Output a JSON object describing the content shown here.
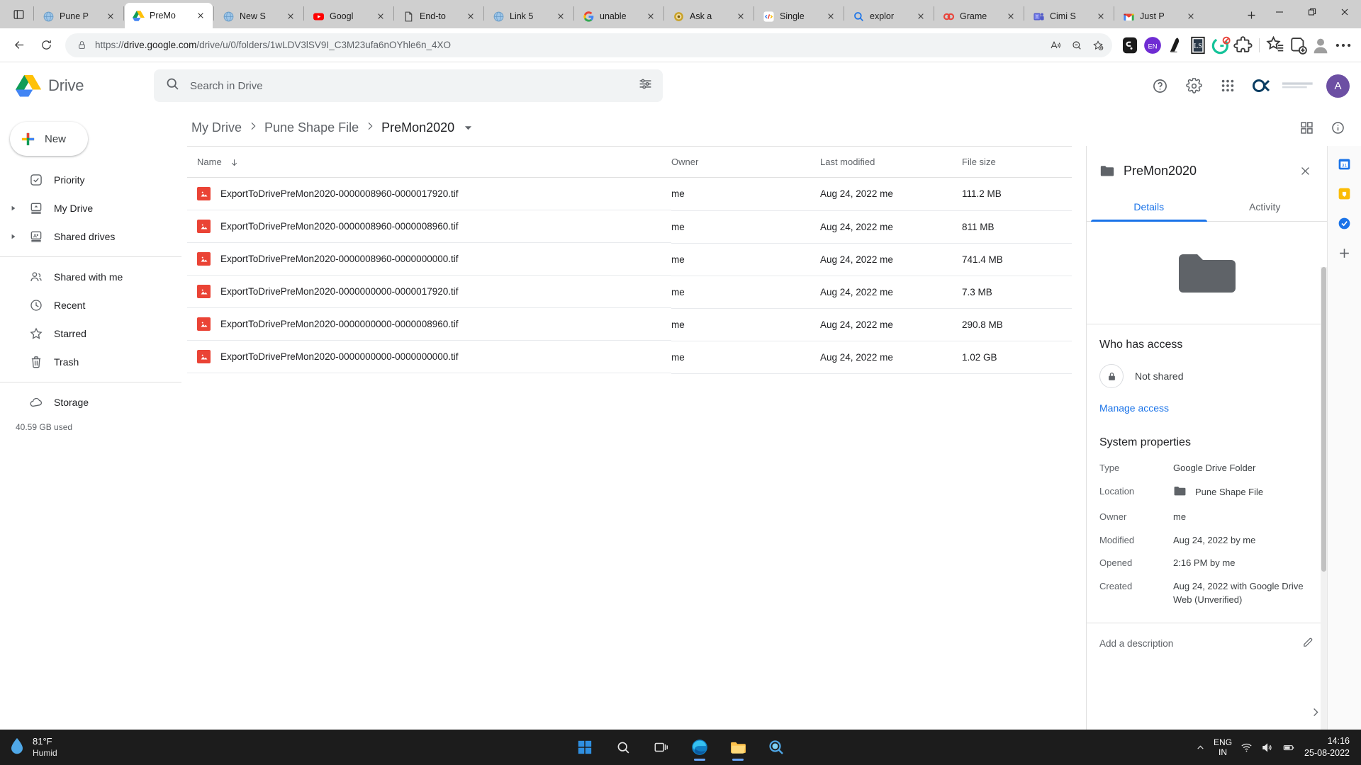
{
  "browser": {
    "tabs": [
      {
        "label": "Pune P",
        "icon": "globe-icon",
        "active": false
      },
      {
        "label": "PreMo",
        "icon": "drive-icon",
        "active": true
      },
      {
        "label": "New S",
        "icon": "globe-icon",
        "active": false
      },
      {
        "label": "Googl",
        "icon": "youtube-icon",
        "active": false
      },
      {
        "label": "End-to",
        "icon": "document-icon",
        "active": false
      },
      {
        "label": "Link 5",
        "icon": "globe-icon",
        "active": false
      },
      {
        "label": "unable",
        "icon": "google-icon",
        "active": false
      },
      {
        "label": "Ask a",
        "icon": "orb-icon",
        "active": false
      },
      {
        "label": "Single",
        "icon": "code-icon",
        "active": false
      },
      {
        "label": "explor",
        "icon": "search-icon",
        "active": false
      },
      {
        "label": "Grame",
        "icon": "grammarly-icon",
        "active": false
      },
      {
        "label": "Cimi S",
        "icon": "teams-icon",
        "active": false
      },
      {
        "label": "Just P",
        "icon": "gmail-icon",
        "active": false
      }
    ],
    "new_tab_label": "+",
    "url_prefix": "https://",
    "url_domain": "drive.google.com",
    "url_path": "/drive/u/0/folders/1wLDV3lSV9I_C3M23ufa6nOYhle6n_4XO",
    "window_controls": {
      "minimize": "—",
      "restore": "❐",
      "close": "✕"
    },
    "extensions": [
      "read-aloud-icon",
      "zoom-out-icon",
      "add-favorite-icon",
      "pocket-extension-icon",
      "en-extension-icon",
      "dark-bird-extension-icon",
      "ls-extension-icon",
      "grammarly-extension-icon",
      "puzzle-extension-icon",
      "favorites-icon",
      "collections-icon",
      "profile-icon",
      "settings-more-icon"
    ]
  },
  "drive": {
    "app_name": "Drive",
    "search": {
      "placeholder": "Search in Drive",
      "value": "",
      "filter_label": "search-options"
    },
    "header_actions": [
      "support-icon",
      "settings-icon",
      "apps-grid-icon"
    ],
    "org_badge": "OK",
    "account_initial": "A",
    "new_button": "New",
    "sidebar": {
      "items": [
        {
          "label": "Priority",
          "icon": "priority-check-icon",
          "expandable": false
        },
        {
          "label": "My Drive",
          "icon": "my-drive-icon",
          "expandable": true
        },
        {
          "label": "Shared drives",
          "icon": "shared-drives-icon",
          "expandable": true
        },
        {
          "label": "Shared with me",
          "icon": "people-icon",
          "expandable": false
        },
        {
          "label": "Recent",
          "icon": "clock-icon",
          "expandable": false
        },
        {
          "label": "Starred",
          "icon": "star-icon",
          "expandable": false
        },
        {
          "label": "Trash",
          "icon": "trash-icon",
          "expandable": false
        },
        {
          "label": "Storage",
          "icon": "cloud-icon",
          "expandable": false
        }
      ],
      "storage_used": "40.59 GB used"
    },
    "breadcrumbs": [
      {
        "label": "My Drive"
      },
      {
        "label": "Pune Shape File"
      },
      {
        "label": "PreMon2020"
      }
    ],
    "view_actions": [
      "grid-view-icon",
      "details-info-icon"
    ],
    "table": {
      "columns": [
        "Name",
        "Owner",
        "Last modified",
        "File size"
      ],
      "sort_column": "Name",
      "sort_direction": "descending",
      "rows": [
        {
          "name": "ExportToDrivePreMon2020-0000008960-0000017920.tif",
          "owner": "me",
          "modified": "Aug 24, 2022  me",
          "size": "111.2 MB",
          "icon": "image-file-icon"
        },
        {
          "name": "ExportToDrivePreMon2020-0000008960-0000008960.tif",
          "owner": "me",
          "modified": "Aug 24, 2022  me",
          "size": "811 MB",
          "icon": "image-file-icon"
        },
        {
          "name": "ExportToDrivePreMon2020-0000008960-0000000000.tif",
          "owner": "me",
          "modified": "Aug 24, 2022  me",
          "size": "741.4 MB",
          "icon": "image-file-icon"
        },
        {
          "name": "ExportToDrivePreMon2020-0000000000-0000017920.tif",
          "owner": "me",
          "modified": "Aug 24, 2022  me",
          "size": "7.3 MB",
          "icon": "image-file-icon"
        },
        {
          "name": "ExportToDrivePreMon2020-0000000000-0000008960.tif",
          "owner": "me",
          "modified": "Aug 24, 2022  me",
          "size": "290.8 MB",
          "icon": "image-file-icon"
        },
        {
          "name": "ExportToDrivePreMon2020-0000000000-0000000000.tif",
          "owner": "me",
          "modified": "Aug 24, 2022  me",
          "size": "1.02 GB",
          "icon": "image-file-icon"
        }
      ]
    },
    "details": {
      "title": "PreMon2020",
      "close_label": "✕",
      "tabs": [
        {
          "label": "Details",
          "active": true
        },
        {
          "label": "Activity",
          "active": false
        }
      ],
      "access_heading": "Who has access",
      "access_status": "Not shared",
      "manage_access": "Manage access",
      "system_heading": "System properties",
      "properties": [
        {
          "key": "Type",
          "value": "Google Drive Folder"
        },
        {
          "key": "Location",
          "value": "Pune Shape File"
        },
        {
          "key": "Owner",
          "value": "me"
        },
        {
          "key": "Modified",
          "value": "Aug 24, 2022 by me"
        },
        {
          "key": "Opened",
          "value": "2:16 PM by me"
        },
        {
          "key": "Created",
          "value": "Aug 24, 2022 with Google Drive Web (Unverified)"
        }
      ],
      "description_placeholder": "Add a description",
      "edit_icon": "pencil-icon"
    },
    "side_rail": [
      "calendar-addon-icon",
      "keep-addon-icon",
      "tasks-addon-icon",
      "add-addon-icon"
    ]
  },
  "taskbar": {
    "weather": {
      "temperature": "81°F",
      "condition": "Humid"
    },
    "apps": [
      "start-icon",
      "search-icon",
      "task-view-icon",
      "edge-icon",
      "file-explorer-icon",
      "photos-icon"
    ],
    "chevron": "show-hidden-icons",
    "language": {
      "line1": "ENG",
      "line2": "IN"
    },
    "tray": [
      "wifi-icon",
      "volume-icon",
      "battery-icon"
    ],
    "clock": {
      "time": "14:16",
      "date": "25-08-2022"
    }
  },
  "colors": {
    "accent": "#1a73e8",
    "drive_blue": "#4285f4",
    "drive_green": "#0f9d58",
    "drive_yellow": "#fbbc04",
    "file_red": "#ea4335",
    "taskbar": "#1c1c1c"
  }
}
